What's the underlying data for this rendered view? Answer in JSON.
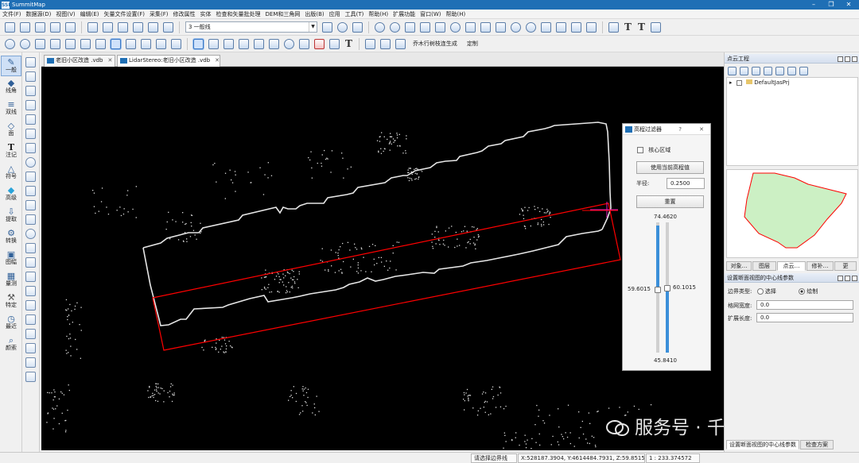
{
  "app": {
    "title": "SummitMap",
    "logo": "SSP",
    "window_controls": [
      "–",
      "❐",
      "✕"
    ]
  },
  "menu": [
    "文件(F)",
    "数据源(D)",
    "视图(V)",
    "编辑(E)",
    "矢量文件设置(F)",
    "采集(F)",
    "修改属性",
    "实体",
    "检查和矢量批处理",
    "DEM和三角网",
    "出版(B)",
    "应用",
    "工具(T)",
    "帮助(H)",
    "扩展功能",
    "窗口(W)",
    "帮助(H)"
  ],
  "toolbar": {
    "layer_select_value": "3 一般线",
    "tree_gen_label": "乔木行树枝连生成",
    "custom_label": "定制"
  },
  "left_tools": [
    {
      "label": "一般",
      "icon": "pencil-icon"
    },
    {
      "label": "线角",
      "icon": "line-corner-icon"
    },
    {
      "label": "双线",
      "icon": "double-line-icon"
    },
    {
      "label": "面",
      "icon": "polygon-icon"
    },
    {
      "label": "注记",
      "icon": "text-icon"
    },
    {
      "label": "符号",
      "icon": "symbol-icon"
    },
    {
      "label": "高级",
      "icon": "diamond-icon"
    },
    {
      "label": "提取",
      "icon": "extract-icon"
    },
    {
      "label": "转换",
      "icon": "convert-icon"
    },
    {
      "label": "图幅",
      "icon": "sheet-icon"
    },
    {
      "label": "量测",
      "icon": "measure-icon"
    },
    {
      "label": "特定",
      "icon": "wrench-icon"
    },
    {
      "label": "最近",
      "icon": "clock-icon"
    },
    {
      "label": "颜索",
      "icon": "search-icon"
    }
  ],
  "tabs": [
    {
      "label": "老旧小区改造 .vdb",
      "close": "✕"
    },
    {
      "label": "LidarStereo:老旧小区改造 .vdb",
      "close": "✕"
    }
  ],
  "filter_dialog": {
    "title": "高程过滤器",
    "help": "?",
    "close": "✕",
    "core_area_label": "核心区域",
    "use_current_btn": "使用当前高程值",
    "radius_label": "半径:",
    "radius_value": "0.2500",
    "reset_btn": "重置",
    "top_value": "74.4620",
    "left_value": "59.6015",
    "right_value": "60.1015",
    "bottom_value": "45.8410"
  },
  "pointcloud_panel": {
    "title": "点云工程",
    "tree_item": "DefaultJasPrj",
    "tabs": [
      "对象…",
      "图层",
      "点云…",
      "修补…",
      "更"
    ]
  },
  "section_panel": {
    "title": "设置断面视图的中心线参数",
    "boundary_label": "边界类型:",
    "opt_select": "选择",
    "opt_draw": "绘制",
    "grid_label": "格网宽度:",
    "grid_value": "0.0",
    "extend_label": "扩展长度:",
    "extend_value": "0.0",
    "bottom_tabs": [
      "设置断面视图的中心线参数",
      "检查方案"
    ]
  },
  "status": {
    "hint": "请选择边界线",
    "coords": "X:528187.3904, Y:4614484.7931, Z:59.8515",
    "scale": "1 : 233.374572"
  },
  "watermark": "服务号 · 千星北斗",
  "colors": {
    "title_blue": "#1f6fb5",
    "selection_red": "#ff0000",
    "region_fill": "#ccf0c4",
    "magenta": "#e020c0"
  }
}
